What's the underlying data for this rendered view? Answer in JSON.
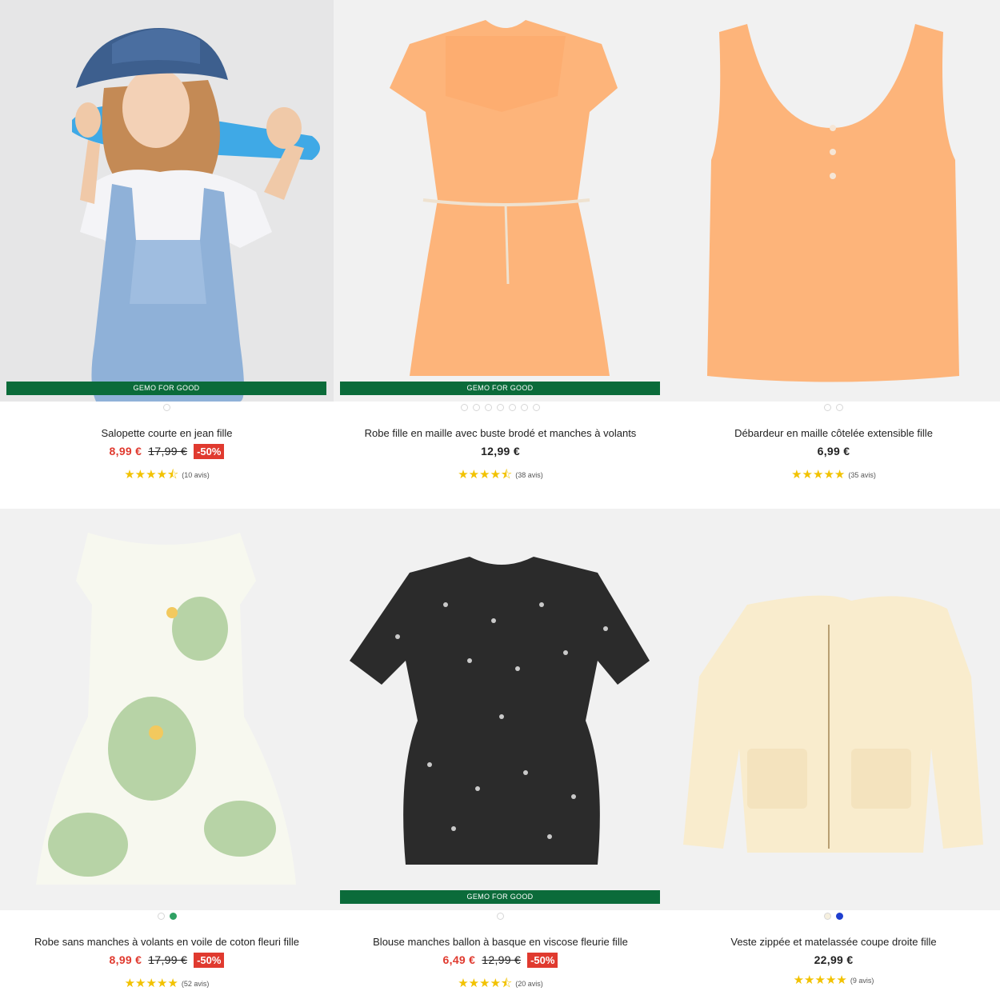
{
  "badge_text": "GEMO FOR GOOD",
  "colors": {
    "badge_green": "#0b6b3a",
    "sale_red": "#e03a2f",
    "star_yellow": "#f2c200"
  },
  "products": [
    {
      "title": "Salopette courte en jean fille",
      "price": "8,99 €",
      "old_price": "17,99 €",
      "discount": "-50%",
      "rating": 4.5,
      "stars": "★★★★⯪",
      "reviews": "(10 avis)",
      "badge": true,
      "image": "girl-denim-overalls-bucket-hat-skateboard"
    },
    {
      "title": "Robe fille en maille avec buste brodé et manches à volants",
      "price": "12,99 €",
      "rating": 4.5,
      "stars": "★★★★⯪",
      "reviews": "(38 avis)",
      "badge": true,
      "image": "orange-dress-flutter-sleeves"
    },
    {
      "title": "Débardeur en maille côtelée extensible fille",
      "price": "6,99 €",
      "rating": 5,
      "stars": "★★★★★",
      "reviews": "(35 avis)",
      "badge": false,
      "image": "orange-ribbed-tank-top"
    },
    {
      "title": "Robe sans manches à volants en voile de coton fleuri fille",
      "price": "8,99 €",
      "old_price": "17,99 €",
      "discount": "-50%",
      "rating": 5,
      "stars": "★★★★★",
      "reviews": "(52 avis)",
      "badge": false,
      "image": "white-green-floral-dress"
    },
    {
      "title": "Blouse manches ballon à basque en viscose fleurie fille",
      "price": "6,49 €",
      "old_price": "12,99 €",
      "discount": "-50%",
      "rating": 4.5,
      "stars": "★★★★⯪",
      "reviews": "(20 avis)",
      "badge": true,
      "image": "black-floral-peplum-blouse"
    },
    {
      "title": "Veste zippée et matelassée coupe droite fille",
      "price": "22,99 €",
      "rating": 5,
      "stars": "★★★★★",
      "reviews": "(9 avis)",
      "badge": false,
      "image": "cream-quilted-jacket"
    }
  ]
}
